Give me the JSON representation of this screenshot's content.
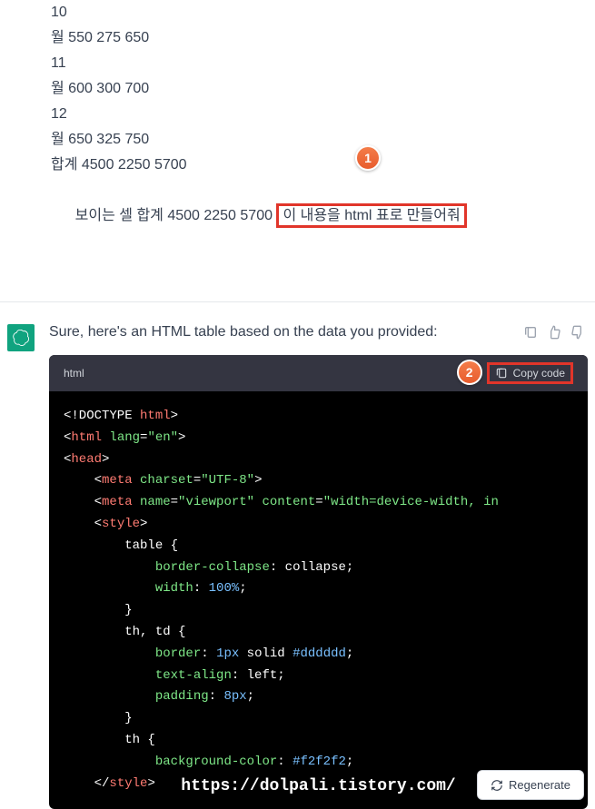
{
  "user": {
    "lines": [
      "10",
      "월 550 275 650",
      "11",
      "월 600 300 700",
      "12",
      "월 650 325 750",
      "합계 4500 2250 5700"
    ],
    "last_line_prefix": "보이는 셀 합계 4500 2250 5700 ",
    "highlighted": "이 내용을 html 표로 만들어줘"
  },
  "callouts": {
    "one": "1",
    "two": "2"
  },
  "assistant": {
    "intro": "Sure, here's an HTML table based on the data you provided:"
  },
  "code": {
    "lang": "html",
    "copy_label": "Copy code"
  },
  "code_tokens": {
    "t1": "<!DOCTYPE ",
    "t1b": "html",
    "t1c": ">",
    "t2a": "<",
    "t2b": "html",
    "t2c": " lang",
    "t2d": "=",
    "t2e": "\"en\"",
    "t2f": ">",
    "t3a": "<",
    "t3b": "head",
    "t3c": ">",
    "t4a": "    <",
    "t4b": "meta",
    "t4c": " charset",
    "t4d": "=",
    "t4e": "\"UTF-8\"",
    "t4f": ">",
    "t5a": "    <",
    "t5b": "meta",
    "t5c": " name",
    "t5d": "=",
    "t5e": "\"viewport\"",
    "t5f": " content",
    "t5g": "=",
    "t5h": "\"width=device-width, in",
    "t6a": "    <",
    "t6b": "style",
    "t6c": ">",
    "t7": "        table {",
    "t8a": "            ",
    "t8b": "border-collapse",
    "t8c": ": collapse;",
    "t9a": "            ",
    "t9b": "width",
    "t9c": ": ",
    "t9d": "100%",
    "t9e": ";",
    "t10": "        }",
    "t11": "        th, td {",
    "t12a": "            ",
    "t12b": "border",
    "t12c": ": ",
    "t12d": "1px",
    "t12e": " solid ",
    "t12f": "#dddddd",
    "t12g": ";",
    "t13a": "            ",
    "t13b": "text-align",
    "t13c": ": left;",
    "t14a": "            ",
    "t14b": "padding",
    "t14c": ": ",
    "t14d": "8px",
    "t14e": ";",
    "t15": "        }",
    "t16": "        th {",
    "t17a": "            ",
    "t17b": "background-color",
    "t17c": ": ",
    "t17d": "#f2f2f2",
    "t17e": ";",
    "t18a": "    </",
    "t18b": "style",
    "t18c": ">"
  },
  "watermark": "https://dolpali.tistory.com/",
  "regenerate": "Regenerate"
}
